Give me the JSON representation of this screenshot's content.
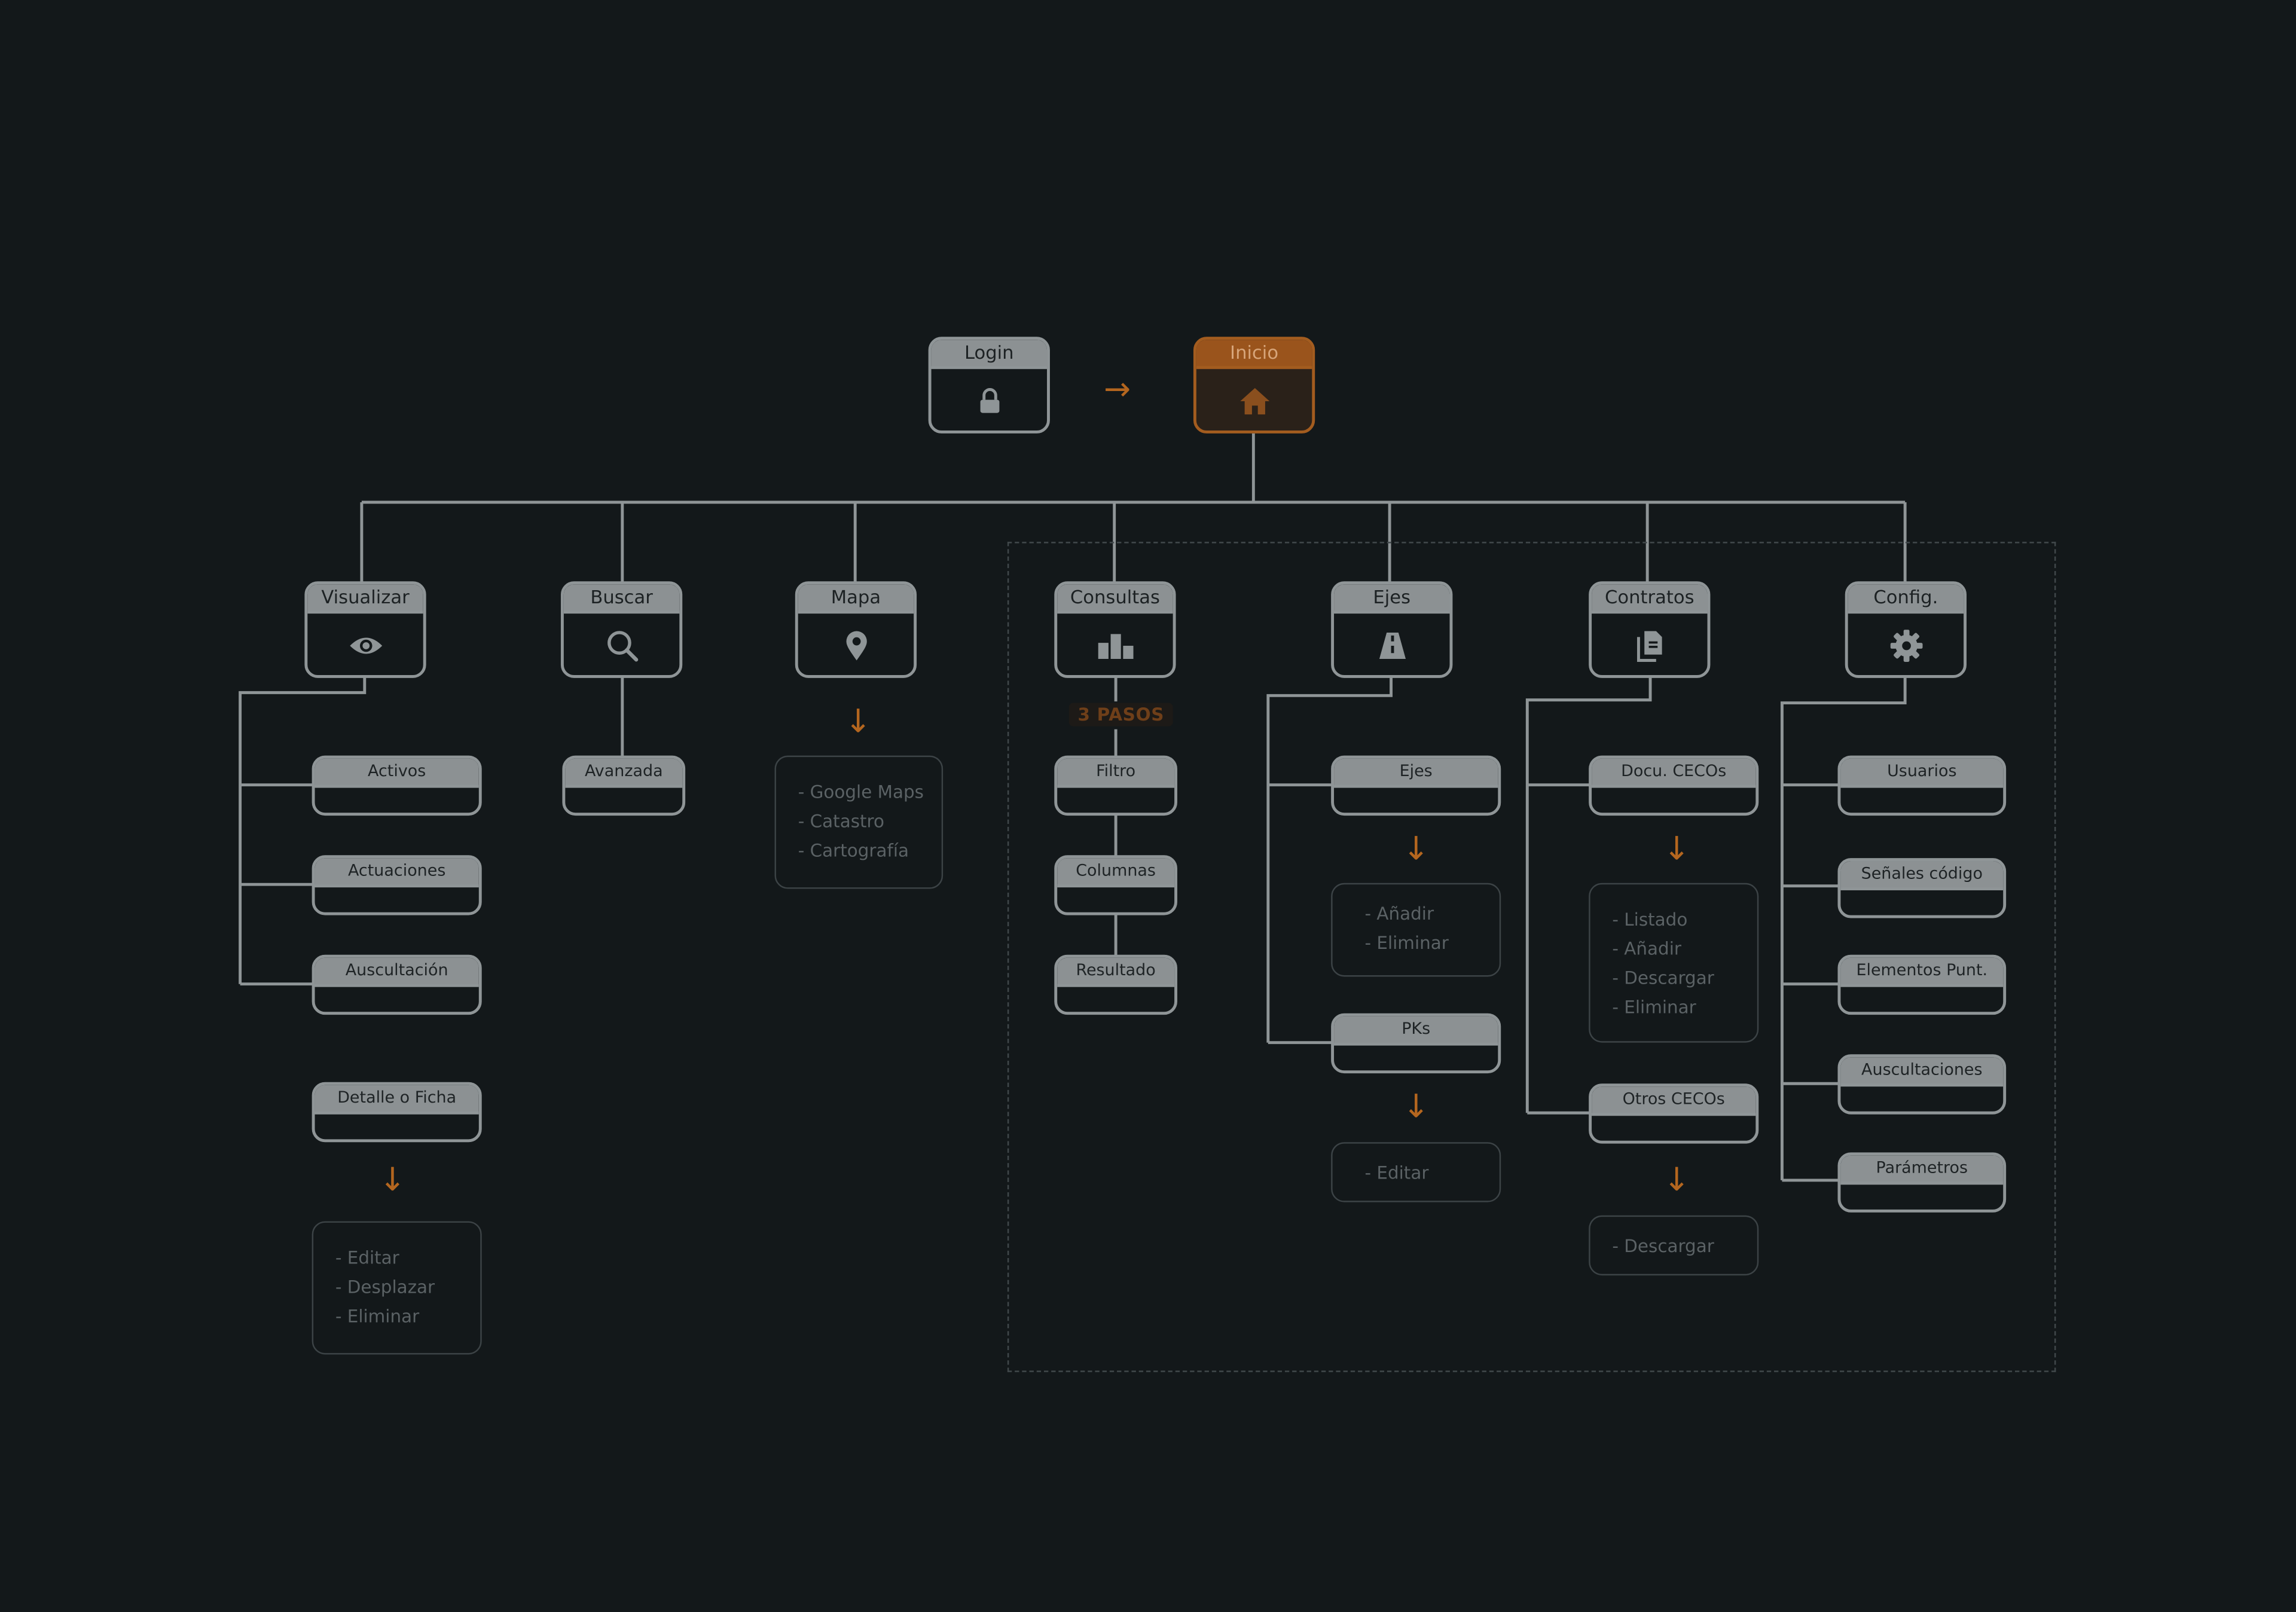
{
  "colors": {
    "background": "#13181a",
    "node_border": "#8f9597",
    "node_header": "#8c9193",
    "accent": "#b4661f",
    "home_fill": "#2a2119",
    "list_text": "#5b6265",
    "badge_text": "#6f3f19"
  },
  "top": {
    "login": {
      "label": "Login",
      "icon": "lock-icon"
    },
    "inicio": {
      "label": "Inicio",
      "icon": "home-icon"
    },
    "flow_arrow": "→"
  },
  "sections": {
    "visualizar": {
      "label": "Visualizar",
      "icon": "eye-icon"
    },
    "buscar": {
      "label": "Buscar",
      "icon": "search-icon"
    },
    "mapa": {
      "label": "Mapa",
      "icon": "map-pin-icon"
    },
    "consultas": {
      "label": "Consultas",
      "icon": "bar-chart-icon"
    },
    "ejes": {
      "label": "Ejes",
      "icon": "road-icon"
    },
    "contratos": {
      "label": "Contratos",
      "icon": "documents-icon"
    },
    "config": {
      "label": "Config.",
      "icon": "gear-icon"
    }
  },
  "visualizar": {
    "items": [
      "Activos",
      "Actuaciones",
      "Auscultación"
    ],
    "detalle": "Detalle o Ficha",
    "detalle_actions": [
      "- Editar",
      "- Desplazar",
      "- Eliminar"
    ]
  },
  "buscar": {
    "items": [
      "Avanzada"
    ]
  },
  "mapa": {
    "options": [
      "- Google Maps",
      "- Catastro",
      "- Cartografía"
    ]
  },
  "consultas": {
    "badge": "3 PASOS",
    "steps": [
      "Filtro",
      "Columnas",
      "Resultado"
    ]
  },
  "ejes": {
    "items": [
      "Ejes",
      "PKs"
    ],
    "ejes_actions": [
      "- Añadir",
      "- Eliminar"
    ],
    "pks_actions": [
      "- Editar"
    ]
  },
  "contratos": {
    "items": [
      "Docu. CECOs",
      "Otros CECOs"
    ],
    "docu_actions": [
      "- Listado",
      "- Añadir",
      "- Descargar",
      "- Eliminar"
    ],
    "otros_actions": [
      "- Descargar"
    ]
  },
  "config": {
    "items": [
      "Usuarios",
      "Señales código",
      "Elementos Punt.",
      "Auscultaciones",
      "Parámetros"
    ]
  },
  "down_arrow": "↓"
}
